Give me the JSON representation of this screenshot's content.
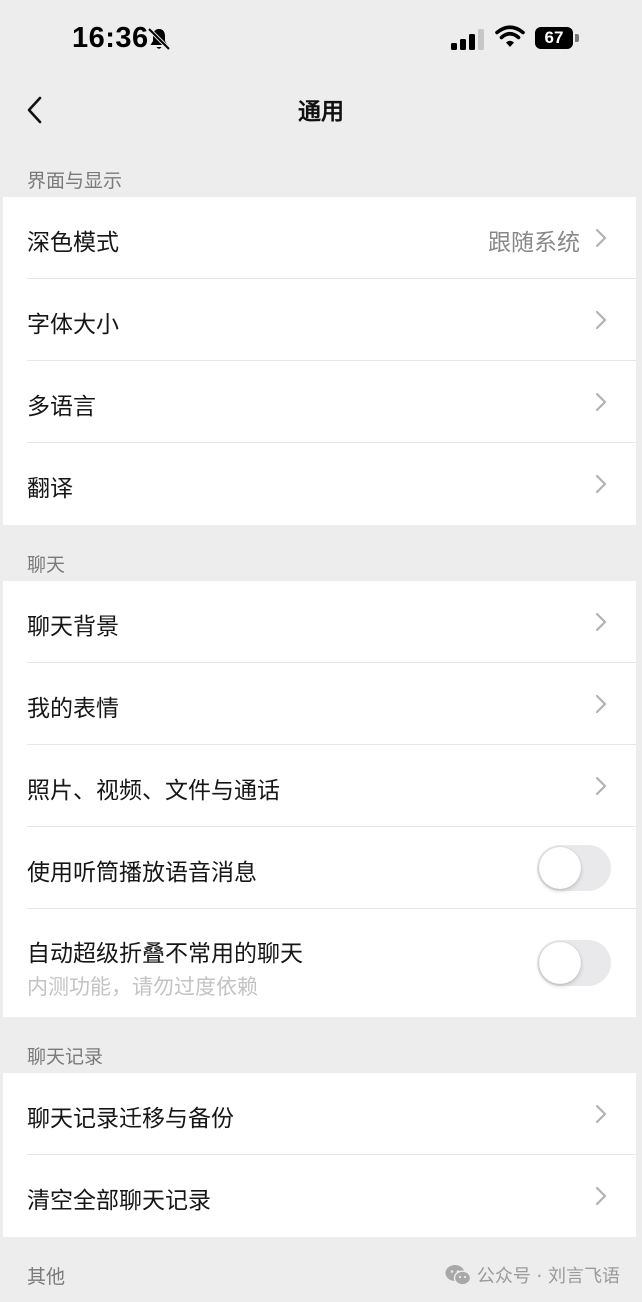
{
  "status_bar": {
    "time": "16:36",
    "battery": "67",
    "icons": [
      "bell-slash-icon",
      "signal-icon",
      "wifi-icon",
      "battery-icon"
    ]
  },
  "nav": {
    "title": "通用",
    "back_icon": "chevron-left-icon"
  },
  "sections": [
    {
      "header": "界面与显示",
      "items": [
        {
          "label": "深色模式",
          "value": "跟随系统",
          "type": "link"
        },
        {
          "label": "字体大小",
          "type": "link"
        },
        {
          "label": "多语言",
          "type": "link"
        },
        {
          "label": "翻译",
          "type": "link"
        }
      ]
    },
    {
      "header": "聊天",
      "items": [
        {
          "label": "聊天背景",
          "type": "link"
        },
        {
          "label": "我的表情",
          "type": "link"
        },
        {
          "label": "照片、视频、文件与通话",
          "type": "link"
        },
        {
          "label": "使用听筒播放语音消息",
          "type": "toggle",
          "on": false
        },
        {
          "label": "自动超级折叠不常用的聊天",
          "sub": "内测功能，请勿过度依赖",
          "type": "toggle",
          "on": false
        }
      ]
    },
    {
      "header": "聊天记录",
      "items": [
        {
          "label": "聊天记录迁移与备份",
          "type": "link"
        },
        {
          "label": "清空全部聊天记录",
          "type": "link"
        }
      ]
    },
    {
      "header": "其他",
      "items": []
    }
  ],
  "watermark": {
    "text": "公众号 · 刘言飞语",
    "icon": "wechat-icon"
  },
  "colors": {
    "background": "#ededed",
    "card": "#ffffff",
    "section_text": "#7a7a7a",
    "value_text": "#888888",
    "toggle_off": "#e9e9eb"
  }
}
